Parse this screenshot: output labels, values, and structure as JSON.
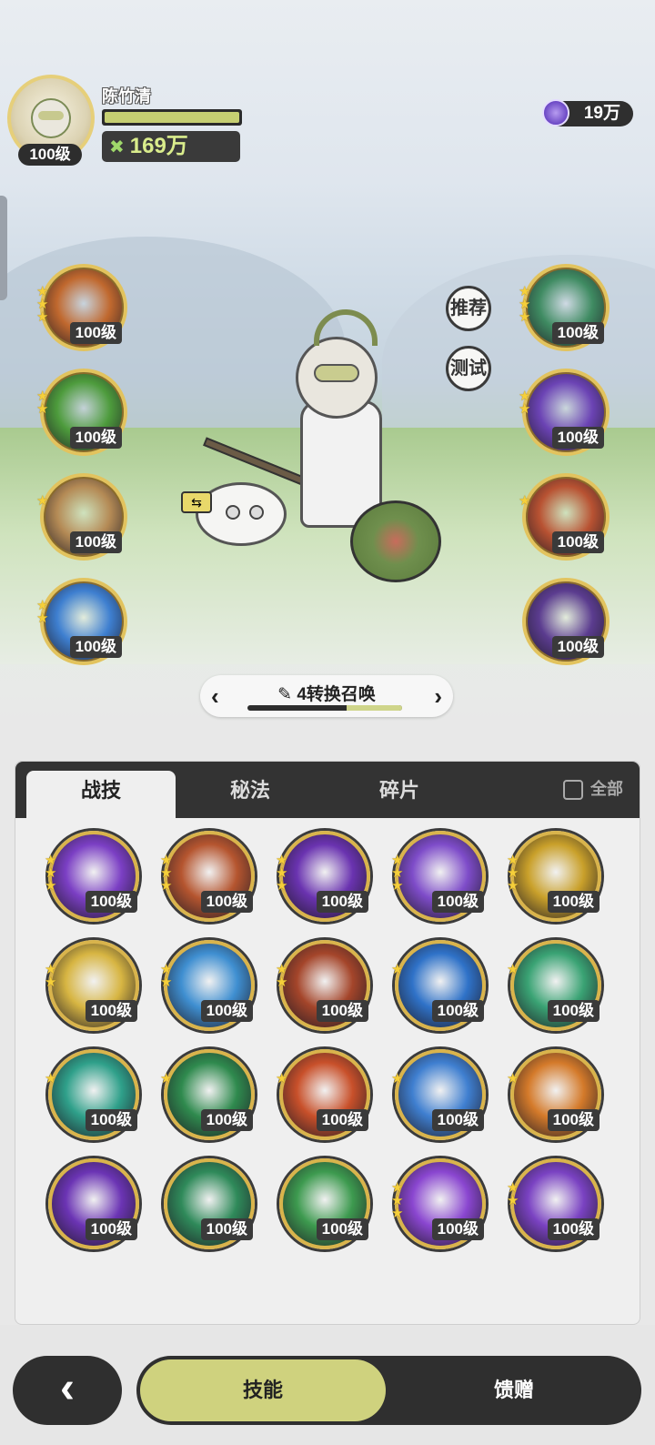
{
  "player": {
    "name": "陈竹清",
    "level": "100级",
    "power": "169万",
    "hp_fill": 1.0
  },
  "currency": {
    "amount": "19万",
    "icon": "purple-gem-icon"
  },
  "side_tags": {
    "recommend": "推荐",
    "test": "测试"
  },
  "left_skills": [
    {
      "level": "100级",
      "stars": 3,
      "color": "#c0682e"
    },
    {
      "level": "100级",
      "stars": 2,
      "color": "#4d9b3c"
    },
    {
      "level": "100级",
      "stars": 1,
      "color": "#b48a55"
    },
    {
      "level": "100级",
      "stars": 2,
      "color": "#3e7fd0"
    }
  ],
  "right_skills": [
    {
      "level": "100级",
      "stars": 3,
      "color": "#3f8b62"
    },
    {
      "level": "100级",
      "stars": 2,
      "color": "#6b43b4"
    },
    {
      "level": "100级",
      "stars": 1,
      "color": "#b85232"
    },
    {
      "level": "100级",
      "stars": 0,
      "color": "#5b3c8f"
    }
  ],
  "form_selector": {
    "label": "4转换召唤",
    "progress": 0.36
  },
  "tabs": [
    {
      "label": "战技",
      "active": true
    },
    {
      "label": "秘法",
      "active": false
    },
    {
      "label": "碎片",
      "active": false
    }
  ],
  "all_toggle": {
    "label": "全部",
    "checked": false
  },
  "skills": [
    {
      "level": "100级",
      "stars": 3,
      "color": "#7b3fc4"
    },
    {
      "level": "100级",
      "stars": 3,
      "color": "#b5552f"
    },
    {
      "level": "100级",
      "stars": 3,
      "color": "#6a33b0"
    },
    {
      "level": "100级",
      "stars": 3,
      "color": "#7e4cc9"
    },
    {
      "level": "100级",
      "stars": 3,
      "color": "#c9a02a"
    },
    {
      "level": "100级",
      "stars": 2,
      "color": "#d7b542"
    },
    {
      "level": "100级",
      "stars": 2,
      "color": "#3f8fd1"
    },
    {
      "level": "100级",
      "stars": 2,
      "color": "#a4452a"
    },
    {
      "level": "100级",
      "stars": 1,
      "color": "#2f72c8"
    },
    {
      "level": "100级",
      "stars": 1,
      "color": "#3aa374"
    },
    {
      "level": "100级",
      "stars": 1,
      "color": "#2fa08a"
    },
    {
      "level": "100级",
      "stars": 1,
      "color": "#2f8a4e"
    },
    {
      "level": "100级",
      "stars": 1,
      "color": "#c8502a"
    },
    {
      "level": "100级",
      "stars": 1,
      "color": "#3f7fd0"
    },
    {
      "level": "100级",
      "stars": 1,
      "color": "#d47a2a"
    },
    {
      "level": "100级",
      "stars": 0,
      "color": "#6b34b4"
    },
    {
      "level": "100级",
      "stars": 0,
      "color": "#2f8a5a"
    },
    {
      "level": "100级",
      "stars": 0,
      "color": "#3d9a4f"
    },
    {
      "level": "100级",
      "stars": 3,
      "color": "#8a46d0"
    },
    {
      "level": "100级",
      "stars": 2,
      "color": "#7a42c2"
    }
  ],
  "bottom_nav": {
    "back_icon": "back-chevron-icon",
    "skill": "技能",
    "gift": "馈赠"
  }
}
